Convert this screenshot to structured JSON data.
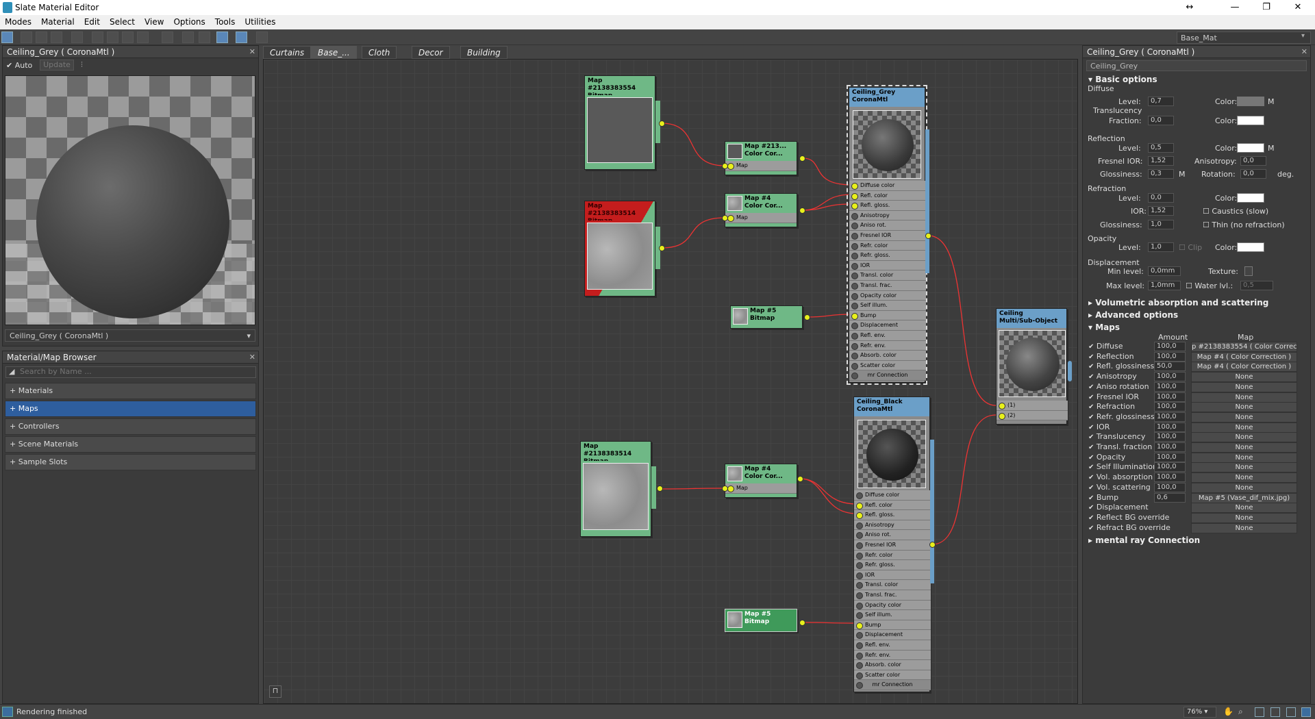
{
  "window": {
    "title": "Slate Material Editor",
    "controls": [
      "↔",
      "—",
      "❐",
      "✕"
    ]
  },
  "menu": [
    "Modes",
    "Material",
    "Edit",
    "Select",
    "View",
    "Options",
    "Tools",
    "Utilities"
  ],
  "material_selector": "Base_Mat",
  "preview": {
    "title": "Ceiling_Grey  ( CoronaMtl )",
    "auto_label": "Auto",
    "update_label": "Update",
    "combo": "Ceiling_Grey  ( CoronaMtl )"
  },
  "browser": {
    "title": "Material/Map Browser",
    "search_placeholder": "Search by Name ...",
    "rows": [
      "+ Materials",
      "+ Maps",
      "+ Controllers",
      "+ Scene Materials",
      "+ Sample Slots"
    ]
  },
  "tabs": [
    "Curtains",
    "Base_...",
    "Cloth",
    "Decor",
    "Building"
  ],
  "nodes": {
    "bm1": {
      "name": "Map #2138383554",
      "type": "Bitmap"
    },
    "bm2": {
      "name": "Map #2138383514",
      "type": "Bitmap"
    },
    "bm3": {
      "name": "Map #2138383514",
      "type": "Bitmap"
    },
    "cc1": {
      "name": "Map #213...",
      "type": "Color Cor...",
      "slot": "Map"
    },
    "cc2": {
      "name": "Map #4",
      "type": "Color Cor...",
      "slot": "Map"
    },
    "cc3": {
      "name": "Map #4",
      "type": "Color Cor...",
      "slot": "Map"
    },
    "m5a": {
      "name": "Map #5",
      "type": "Bitmap"
    },
    "m5b": {
      "name": "Map #5",
      "type": "Bitmap"
    },
    "mat1": {
      "name": "Ceiling_Grey",
      "type": "CoronaMtl"
    },
    "mat2": {
      "name": "Ceiling_Black",
      "type": "CoronaMtl"
    },
    "multi": {
      "name": "Ceiling",
      "type": "Multi/Sub-Object",
      "slots": [
        "(1)",
        "(2)"
      ]
    },
    "slots": [
      "Diffuse color",
      "Refl. color",
      "Refl. gloss.",
      "Anisotropy",
      "Aniso rot.",
      "Fresnel IOR",
      "Refr. color",
      "Refr. gloss.",
      "IOR",
      "Transl. color",
      "Transl. frac.",
      "Opacity color",
      "Self illum.",
      "Bump",
      "Displacement",
      "Refl. env.",
      "Refr. env.",
      "Absorb. color",
      "Scatter color",
      "mr Connection"
    ]
  },
  "props": {
    "title": "Ceiling_Grey  ( CoronaMtl )",
    "name": "Ceiling_Grey",
    "basic": "Basic options",
    "diffuse": "Diffuse",
    "level": "Level:",
    "color": "Color:",
    "m": "M",
    "diffuse_level": "0,7",
    "translucency": "Translucency",
    "fraction": "Fraction:",
    "fraction_val": "0,0",
    "reflection": "Reflection",
    "refl_level": "0,5",
    "fresnel": "Fresnel IOR:",
    "fresnel_val": "1,52",
    "aniso": "Anisotropy:",
    "aniso_val": "0,0",
    "gloss": "Glossiness:",
    "gloss_val": "0,3",
    "rotation": "Rotation:",
    "rotation_val": "0,0",
    "deg": "deg.",
    "refraction": "Refraction",
    "refr_level": "0,0",
    "ior": "IOR:",
    "ior_val": "1,52",
    "caustics": "Caustics (slow)",
    "refr_gloss_val": "1,0",
    "thin": "Thin (no refraction)",
    "opacity": "Opacity",
    "op_level": "1,0",
    "clip": "Clip",
    "displacement": "Displacement",
    "minlvl": "Min level:",
    "minlvl_val": "0,0mm",
    "texture": "Texture:",
    "maxlvl": "Max level:",
    "maxlvl_val": "1,0mm",
    "water": "Water lvl.:",
    "water_val": "0,5",
    "vol": "Volumetric absorption and scattering",
    "adv": "Advanced options",
    "maps": "Maps",
    "amount_h": "Amount",
    "map_h": "Map",
    "map_rows": [
      {
        "n": "Diffuse",
        "a": "100,0",
        "m": "p #2138383554  ( Color Correctio"
      },
      {
        "n": "Reflection",
        "a": "100,0",
        "m": "Map #4  ( Color Correction )"
      },
      {
        "n": "Refl. glossiness",
        "a": "50,0",
        "m": "Map #4  ( Color Correction )"
      },
      {
        "n": "Anisotropy",
        "a": "100,0",
        "m": "None"
      },
      {
        "n": "Aniso rotation",
        "a": "100,0",
        "m": "None"
      },
      {
        "n": "Fresnel IOR",
        "a": "100,0",
        "m": "None"
      },
      {
        "n": "Refraction",
        "a": "100,0",
        "m": "None"
      },
      {
        "n": "Refr. glossiness",
        "a": "100,0",
        "m": "None"
      },
      {
        "n": "IOR",
        "a": "100,0",
        "m": "None"
      },
      {
        "n": "Translucency",
        "a": "100,0",
        "m": "None"
      },
      {
        "n": "Transl. fraction",
        "a": "100,0",
        "m": "None"
      },
      {
        "n": "Opacity",
        "a": "100,0",
        "m": "None"
      },
      {
        "n": "Self Illumination",
        "a": "100,0",
        "m": "None"
      },
      {
        "n": "Vol. absorption",
        "a": "100,0",
        "m": "None"
      },
      {
        "n": "Vol. scattering",
        "a": "100,0",
        "m": "None"
      },
      {
        "n": "Bump",
        "a": "0,6",
        "m": "Map #5 (Vase_dif_mix.jpg)"
      },
      {
        "n": "Displacement",
        "a": "",
        "m": "None"
      },
      {
        "n": "Reflect BG override",
        "a": "",
        "m": "None"
      },
      {
        "n": "Refract BG override",
        "a": "",
        "m": "None"
      }
    ],
    "mr": "mental ray Connection"
  },
  "status": {
    "text": "Rendering finished",
    "zoom": "76%"
  }
}
